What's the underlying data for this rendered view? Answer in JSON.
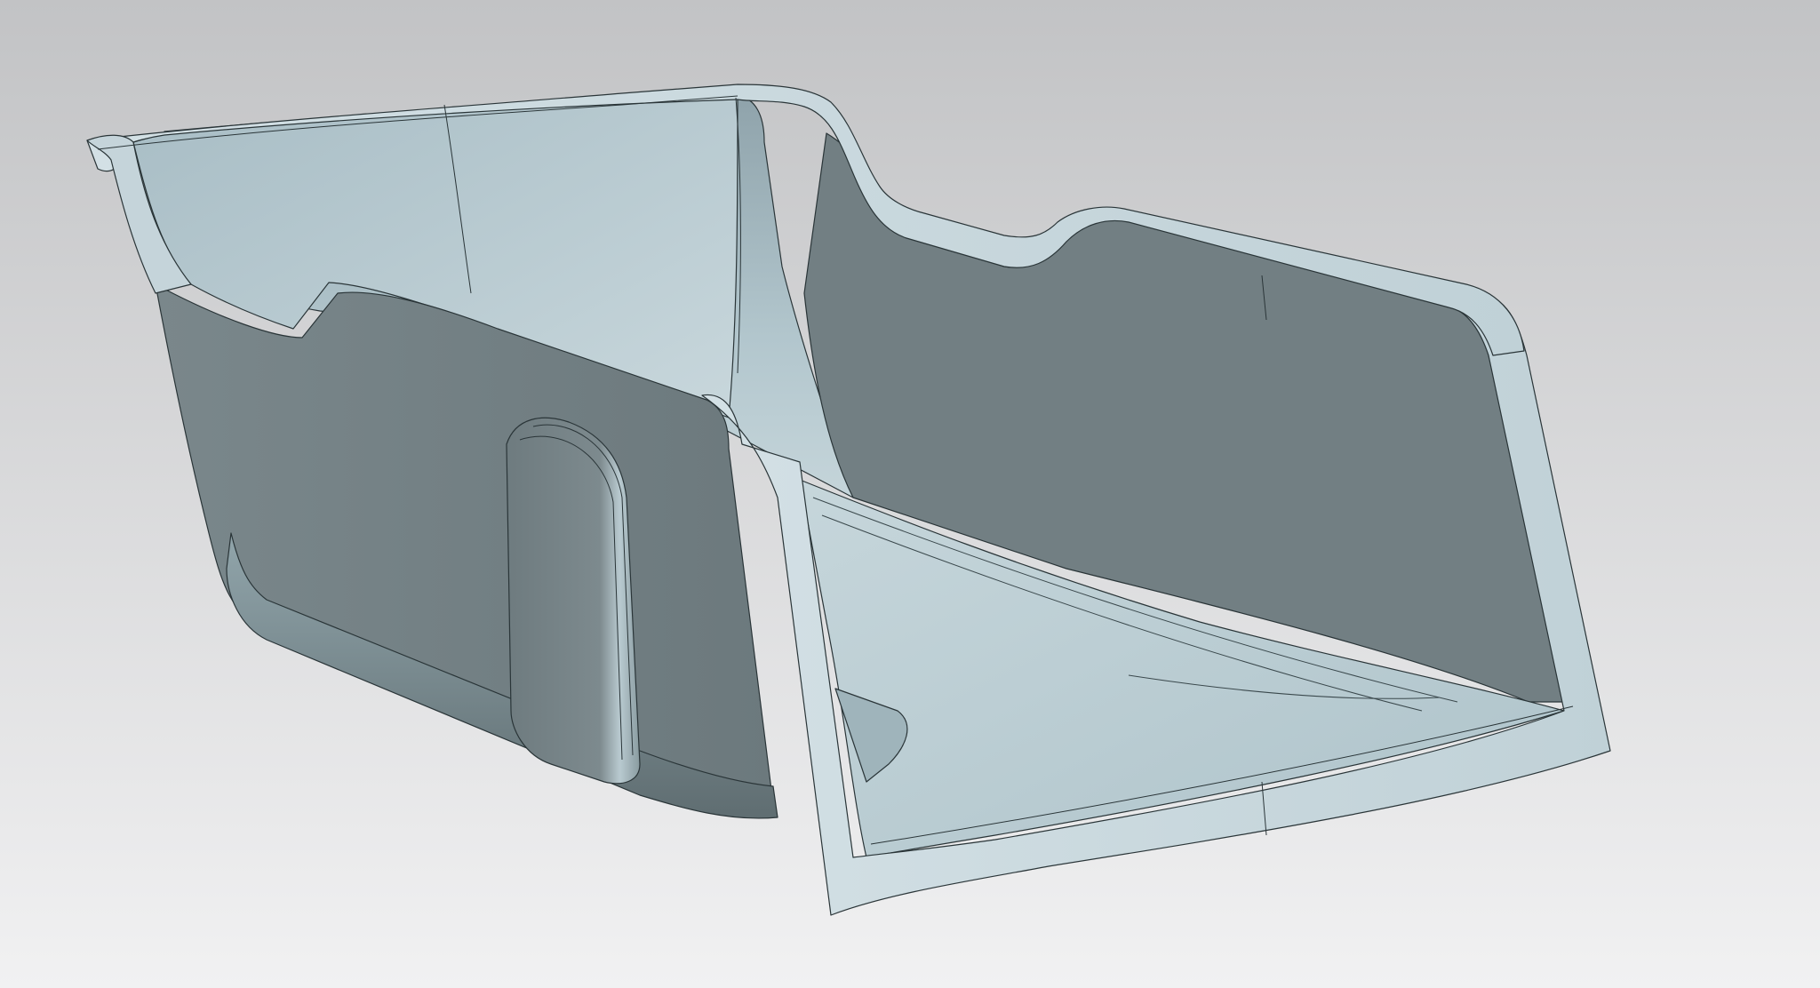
{
  "viewport": {
    "kind": "3d-cad-viewport",
    "background": {
      "top_color": "#c2c3c5",
      "bottom_color": "#f1f1f2"
    },
    "model": {
      "name": "",
      "surface_colors": {
        "rim_highlight": "#cfdde3",
        "outer_light": "#b6c8cf",
        "inner_mid": "#a9bec6",
        "shadow_wall": "#727f83",
        "floor": "#b7ccd3",
        "edge_line": "#2a3538"
      }
    }
  }
}
